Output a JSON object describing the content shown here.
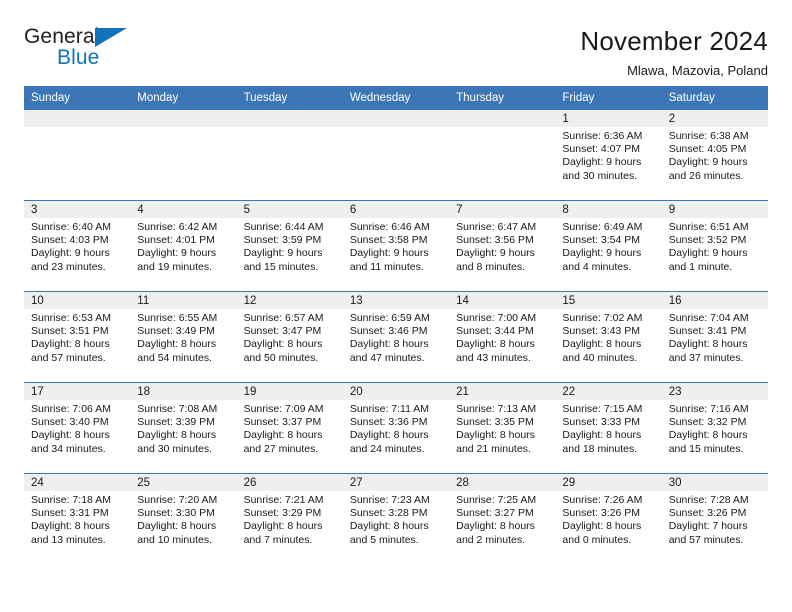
{
  "brand": {
    "name_part1": "General",
    "name_part2": "Blue",
    "triangle_color": "#1272bb"
  },
  "header": {
    "title": "November 2024",
    "subtitle": "Mlawa, Mazovia, Poland",
    "accent_color": "#3d76b6",
    "daynum_band_color": "#efefef"
  },
  "weekday_headers": [
    "Sunday",
    "Monday",
    "Tuesday",
    "Wednesday",
    "Thursday",
    "Friday",
    "Saturday"
  ],
  "weeks": [
    [
      {
        "day": "",
        "blank": true
      },
      {
        "day": "",
        "blank": true
      },
      {
        "day": "",
        "blank": true
      },
      {
        "day": "",
        "blank": true
      },
      {
        "day": "",
        "blank": true
      },
      {
        "day": "1",
        "sunrise": "Sunrise: 6:36 AM",
        "sunset": "Sunset: 4:07 PM",
        "daylight": "Daylight: 9 hours and 30 minutes."
      },
      {
        "day": "2",
        "sunrise": "Sunrise: 6:38 AM",
        "sunset": "Sunset: 4:05 PM",
        "daylight": "Daylight: 9 hours and 26 minutes."
      }
    ],
    [
      {
        "day": "3",
        "sunrise": "Sunrise: 6:40 AM",
        "sunset": "Sunset: 4:03 PM",
        "daylight": "Daylight: 9 hours and 23 minutes."
      },
      {
        "day": "4",
        "sunrise": "Sunrise: 6:42 AM",
        "sunset": "Sunset: 4:01 PM",
        "daylight": "Daylight: 9 hours and 19 minutes."
      },
      {
        "day": "5",
        "sunrise": "Sunrise: 6:44 AM",
        "sunset": "Sunset: 3:59 PM",
        "daylight": "Daylight: 9 hours and 15 minutes."
      },
      {
        "day": "6",
        "sunrise": "Sunrise: 6:46 AM",
        "sunset": "Sunset: 3:58 PM",
        "daylight": "Daylight: 9 hours and 11 minutes."
      },
      {
        "day": "7",
        "sunrise": "Sunrise: 6:47 AM",
        "sunset": "Sunset: 3:56 PM",
        "daylight": "Daylight: 9 hours and 8 minutes."
      },
      {
        "day": "8",
        "sunrise": "Sunrise: 6:49 AM",
        "sunset": "Sunset: 3:54 PM",
        "daylight": "Daylight: 9 hours and 4 minutes."
      },
      {
        "day": "9",
        "sunrise": "Sunrise: 6:51 AM",
        "sunset": "Sunset: 3:52 PM",
        "daylight": "Daylight: 9 hours and 1 minute."
      }
    ],
    [
      {
        "day": "10",
        "sunrise": "Sunrise: 6:53 AM",
        "sunset": "Sunset: 3:51 PM",
        "daylight": "Daylight: 8 hours and 57 minutes."
      },
      {
        "day": "11",
        "sunrise": "Sunrise: 6:55 AM",
        "sunset": "Sunset: 3:49 PM",
        "daylight": "Daylight: 8 hours and 54 minutes."
      },
      {
        "day": "12",
        "sunrise": "Sunrise: 6:57 AM",
        "sunset": "Sunset: 3:47 PM",
        "daylight": "Daylight: 8 hours and 50 minutes."
      },
      {
        "day": "13",
        "sunrise": "Sunrise: 6:59 AM",
        "sunset": "Sunset: 3:46 PM",
        "daylight": "Daylight: 8 hours and 47 minutes."
      },
      {
        "day": "14",
        "sunrise": "Sunrise: 7:00 AM",
        "sunset": "Sunset: 3:44 PM",
        "daylight": "Daylight: 8 hours and 43 minutes."
      },
      {
        "day": "15",
        "sunrise": "Sunrise: 7:02 AM",
        "sunset": "Sunset: 3:43 PM",
        "daylight": "Daylight: 8 hours and 40 minutes."
      },
      {
        "day": "16",
        "sunrise": "Sunrise: 7:04 AM",
        "sunset": "Sunset: 3:41 PM",
        "daylight": "Daylight: 8 hours and 37 minutes."
      }
    ],
    [
      {
        "day": "17",
        "sunrise": "Sunrise: 7:06 AM",
        "sunset": "Sunset: 3:40 PM",
        "daylight": "Daylight: 8 hours and 34 minutes."
      },
      {
        "day": "18",
        "sunrise": "Sunrise: 7:08 AM",
        "sunset": "Sunset: 3:39 PM",
        "daylight": "Daylight: 8 hours and 30 minutes."
      },
      {
        "day": "19",
        "sunrise": "Sunrise: 7:09 AM",
        "sunset": "Sunset: 3:37 PM",
        "daylight": "Daylight: 8 hours and 27 minutes."
      },
      {
        "day": "20",
        "sunrise": "Sunrise: 7:11 AM",
        "sunset": "Sunset: 3:36 PM",
        "daylight": "Daylight: 8 hours and 24 minutes."
      },
      {
        "day": "21",
        "sunrise": "Sunrise: 7:13 AM",
        "sunset": "Sunset: 3:35 PM",
        "daylight": "Daylight: 8 hours and 21 minutes."
      },
      {
        "day": "22",
        "sunrise": "Sunrise: 7:15 AM",
        "sunset": "Sunset: 3:33 PM",
        "daylight": "Daylight: 8 hours and 18 minutes."
      },
      {
        "day": "23",
        "sunrise": "Sunrise: 7:16 AM",
        "sunset": "Sunset: 3:32 PM",
        "daylight": "Daylight: 8 hours and 15 minutes."
      }
    ],
    [
      {
        "day": "24",
        "sunrise": "Sunrise: 7:18 AM",
        "sunset": "Sunset: 3:31 PM",
        "daylight": "Daylight: 8 hours and 13 minutes."
      },
      {
        "day": "25",
        "sunrise": "Sunrise: 7:20 AM",
        "sunset": "Sunset: 3:30 PM",
        "daylight": "Daylight: 8 hours and 10 minutes."
      },
      {
        "day": "26",
        "sunrise": "Sunrise: 7:21 AM",
        "sunset": "Sunset: 3:29 PM",
        "daylight": "Daylight: 8 hours and 7 minutes."
      },
      {
        "day": "27",
        "sunrise": "Sunrise: 7:23 AM",
        "sunset": "Sunset: 3:28 PM",
        "daylight": "Daylight: 8 hours and 5 minutes."
      },
      {
        "day": "28",
        "sunrise": "Sunrise: 7:25 AM",
        "sunset": "Sunset: 3:27 PM",
        "daylight": "Daylight: 8 hours and 2 minutes."
      },
      {
        "day": "29",
        "sunrise": "Sunrise: 7:26 AM",
        "sunset": "Sunset: 3:26 PM",
        "daylight": "Daylight: 8 hours and 0 minutes."
      },
      {
        "day": "30",
        "sunrise": "Sunrise: 7:28 AM",
        "sunset": "Sunset: 3:26 PM",
        "daylight": "Daylight: 7 hours and 57 minutes."
      }
    ]
  ]
}
